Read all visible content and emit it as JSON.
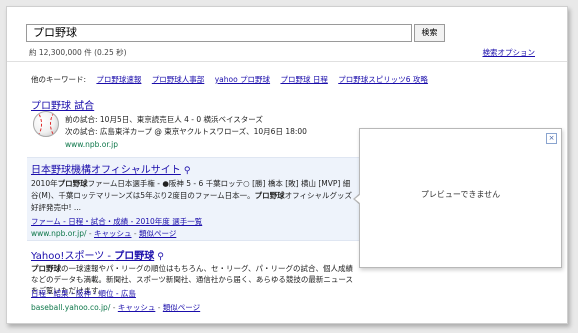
{
  "search": {
    "query": "プロ野球",
    "button_label": "検索",
    "result_count": "約 12,300,000 件 (0.25 秒)",
    "options_link": "検索オプション"
  },
  "related": {
    "label": "他のキーワード:",
    "items": [
      "プロ野球速報",
      "プロ野球人事部",
      "yahoo プロ野球",
      "プロ野球 日程",
      "プロ野球スピリッツ6 攻略"
    ]
  },
  "results": [
    {
      "title": "プロ野球 試合",
      "prev_game": "前の試合: 10月5日、東京読売巨人 4 - 0 横浜ベイスターズ",
      "next_game": "次の試合: 広島東洋カープ @ 東京ヤクルトスワローズ、10月6日 18:00",
      "url": "www.npb.or.jp"
    },
    {
      "title": "日本野球機構オフィシャルサイト",
      "snippet_1_pre": "2010年",
      "snippet_1_bold": "プロ野球",
      "snippet_1_post": "ファーム日本選手権 - ●阪神 5 - 6 千葉ロッテ○ [勝] 橋本 [敗] 横山 [MVP] 細谷",
      "snippet_2": "(M)、千葉ロッテマリーンズは5年ぶり2度目のファーム日本一。",
      "snippet_2_bold": "プロ野球",
      "snippet_2_post": "オフィシャルグッズ好評発売中! ...",
      "sitelinks": "ファーム - 日程・試合・成績 - 2010年度 選手一覧",
      "url": "www.npb.or.jp/",
      "cache": "キャッシュ",
      "similar": "類似ページ"
    },
    {
      "title_pre": "Yahoo!スポーツ - ",
      "title_bold": "プロ野球",
      "snippet_bold": "プロ野球",
      "snippet_1": "の一球速報やパ・リーグの順位はもちろん、セ・リーグ、パ・リーグの試合、個人成績などのデータも満",
      "snippet_2": "載。新聞社、スポーツ新聞社、通信社から届く、あらゆる競技の最新ニュースをご覧いただけます。",
      "sitelinks": "日程・結果 - 阪神 - 順位 - 広島",
      "url": "baseball.yahoo.co.jp/",
      "cache": "キャッシュ",
      "similar": "類似ページ"
    }
  ],
  "preview": {
    "close_label": "×",
    "message": "プレビューできません"
  },
  "icons": {
    "magnifier": "magnifier-icon",
    "baseball": "baseball-icon"
  },
  "colors": {
    "link": "#1a0dab",
    "url_green": "#0e774a",
    "highlight_bg": "#eef3fb"
  }
}
